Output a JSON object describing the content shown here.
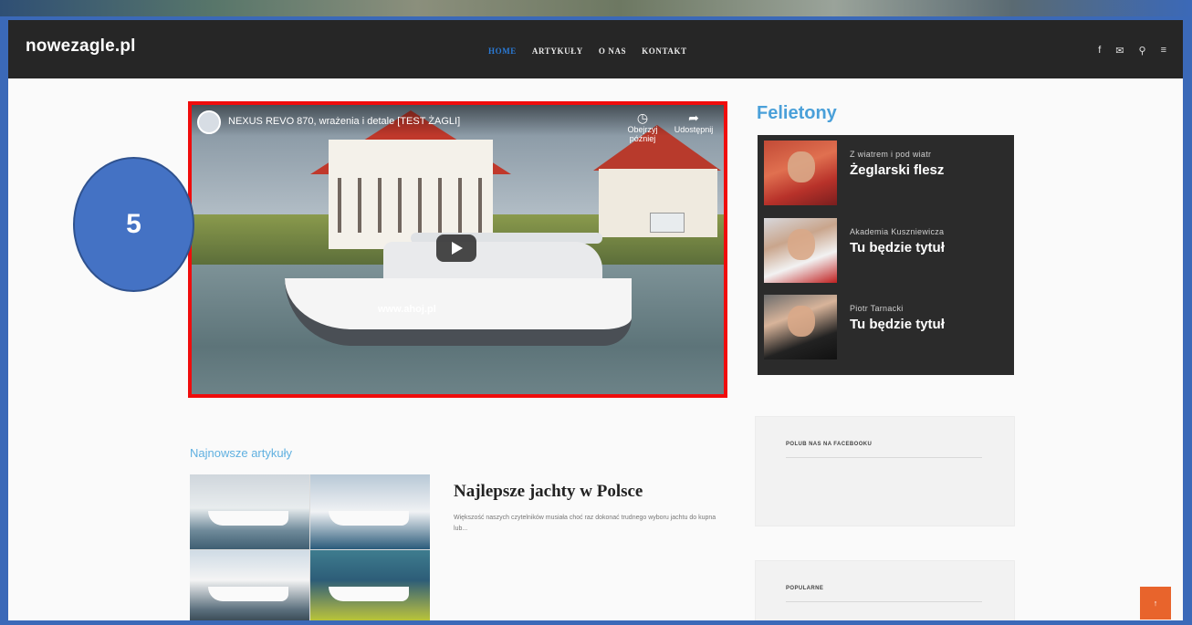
{
  "site": {
    "logo": "nowezagle.pl"
  },
  "nav": {
    "items": [
      {
        "label": "HOME",
        "active": true
      },
      {
        "label": "ARTYKUŁY",
        "active": false
      },
      {
        "label": "O NAS",
        "active": false
      },
      {
        "label": "KONTAKT",
        "active": false
      }
    ],
    "icons": [
      "facebook-icon",
      "mail-icon",
      "search-icon",
      "menu-icon"
    ],
    "icon_glyphs": [
      "f",
      "✉",
      "⚲",
      "≡"
    ]
  },
  "video": {
    "title": "NEXUS REVO 870, wrażenia i detale [TEST ŻAGLI]",
    "watch_later": "Obejrzyj później",
    "share": "Udostępnij",
    "boat_text": "www.ahoj.pl",
    "border_color": "#f00c0c"
  },
  "badge": {
    "number": "5",
    "color": "#4472c4"
  },
  "felietony": {
    "title": "Felietony",
    "items": [
      {
        "subtitle": "Z wiatrem i pod wiatr",
        "title": "Żeglarski flesz"
      },
      {
        "subtitle": "Akademia Kuszniewicza",
        "title": "Tu będzie tytuł"
      },
      {
        "subtitle": "Piotr Tarnacki",
        "title": "Tu będzie tytuł"
      }
    ]
  },
  "widgets": {
    "facebook": "POLUB NAS NA FACEBOOKU",
    "popular": "POPULARNE"
  },
  "articles": {
    "section_title": "Najnowsze artykuły",
    "items": [
      {
        "title": "Najlepsze jachty w Polsce",
        "excerpt": "Większość naszych czytelników musiała choć raz dokonać trudnego wyboru jachtu do kupna lub..."
      }
    ]
  },
  "scroll_top": {
    "label": "↑"
  },
  "colors": {
    "accent": "#4aa0d9",
    "nav_bg": "#262626",
    "orange": "#e8642c"
  }
}
